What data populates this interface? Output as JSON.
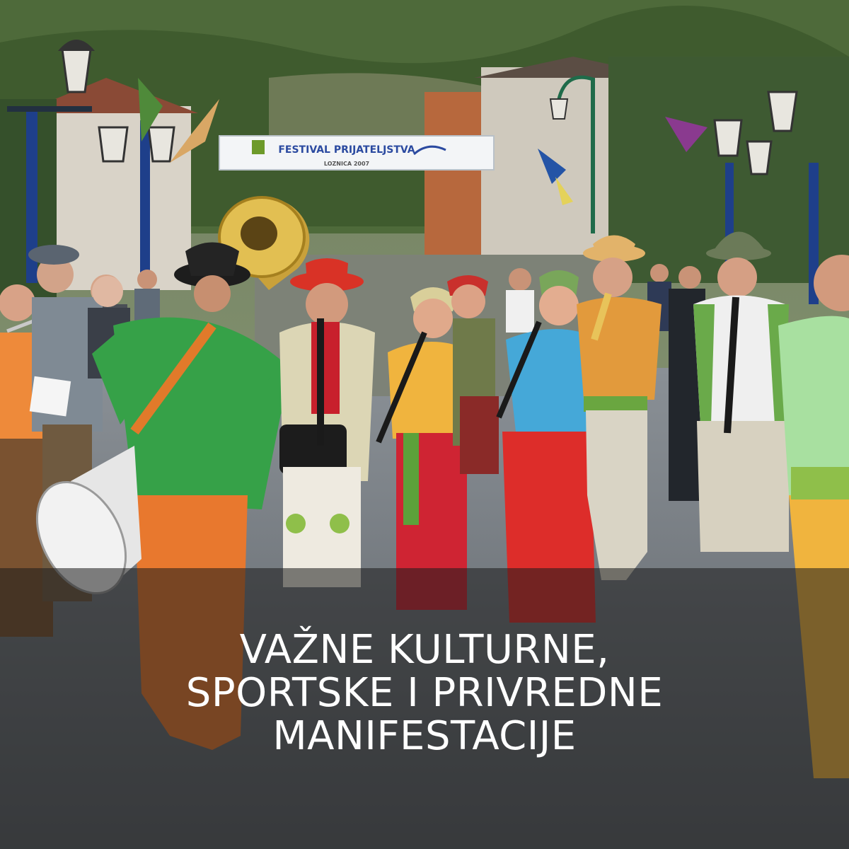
{
  "banner": {
    "title": "FESTIVAL PRIJATELJSTVA",
    "subtitle": "LOZNICA 2007"
  },
  "caption": {
    "lines": [
      "VAŽNE KULTURNE,",
      "SPORTSKE I PRIVREDNE",
      "MANIFESTACIJE"
    ]
  },
  "colors": {
    "overlay": "#1c1c1c",
    "caption_text": "#ffffff"
  }
}
